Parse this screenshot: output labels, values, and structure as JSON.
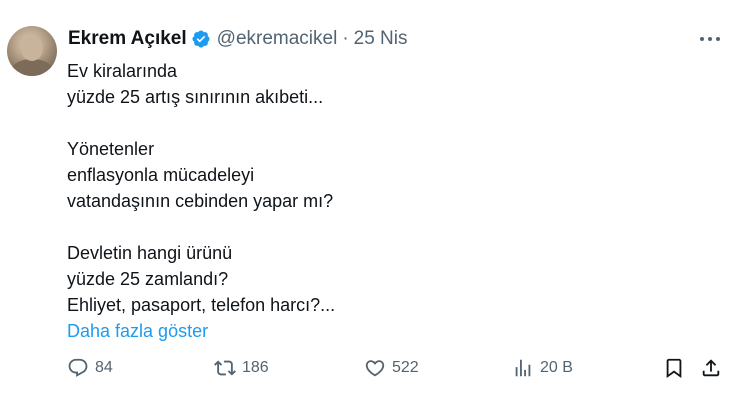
{
  "author": {
    "name": "Ekrem Açıkel",
    "handle": "@ekremacikel",
    "separator": "·",
    "date": "25 Nis"
  },
  "tweet": {
    "lines": [
      "Ev kiralarında",
      "yüzde 25 artış sınırının akıbeti...",
      "",
      "Yönetenler",
      "enflasyonla mücadeleyi",
      "vatandaşının cebinden yapar mı?",
      "",
      "Devletin hangi ürünü",
      "yüzde 25 zamlandı?",
      "Ehliyet, pasaport, telefon harcı?..."
    ],
    "show_more": "Daha fazla göster"
  },
  "actions": {
    "replies": "84",
    "retweets": "186",
    "likes": "522",
    "views": "20 B"
  },
  "colors": {
    "accent": "#1d9bf0",
    "muted": "#536471",
    "text": "#0f1419"
  },
  "icons": [
    "verified-badge-icon",
    "more-options-icon",
    "reply-icon",
    "retweet-icon",
    "like-icon",
    "views-icon",
    "bookmark-icon",
    "share-icon"
  ]
}
